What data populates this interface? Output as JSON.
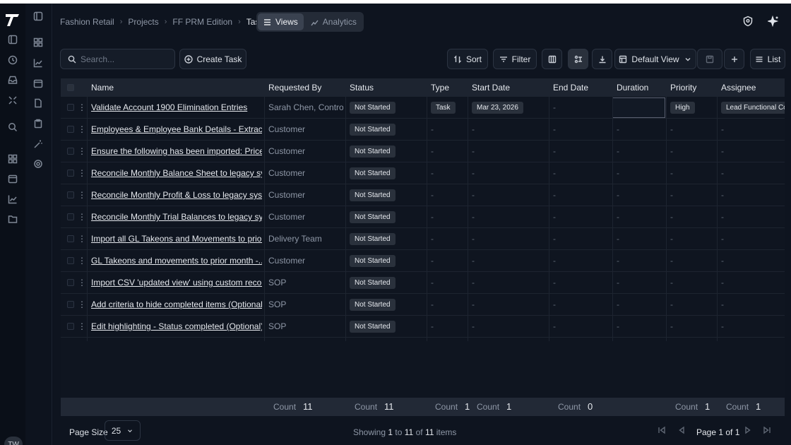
{
  "breadcrumb": [
    "Fashion Retail",
    "Projects",
    "FF PRM Edition",
    "Tasks"
  ],
  "view_tabs": {
    "views": "Views",
    "analytics": "Analytics"
  },
  "toolbar": {
    "search_placeholder": "Search...",
    "create_task": "Create Task",
    "sort": "Sort",
    "filter": "Filter",
    "default_view": "Default View",
    "list": "List"
  },
  "columns": [
    "Name",
    "Requested By",
    "Status",
    "Type",
    "Start Date",
    "End Date",
    "Duration",
    "Priority",
    "Assignee"
  ],
  "rows": [
    {
      "name": "Validate Account 1900 Elimination Entries",
      "requested_by": "Sarah Chen, Control...",
      "status": "Not Started",
      "type": "Task",
      "start": "Mar 23, 2026",
      "end": "-",
      "duration": "",
      "priority": "High",
      "assignee": "Lead Functional Cor"
    },
    {
      "name": "Employees & Employee Bank Details - Extract and...",
      "requested_by": "Customer",
      "status": "Not Started",
      "type": "-",
      "start": "-",
      "end": "-",
      "duration": "-",
      "priority": "-",
      "assignee": "-"
    },
    {
      "name": "Ensure the following has been imported: Price...",
      "requested_by": "Customer",
      "status": "Not Started",
      "type": "-",
      "start": "-",
      "end": "-",
      "duration": "-",
      "priority": "-",
      "assignee": "-"
    },
    {
      "name": "Reconcile Monthly Balance Sheet to legacy system",
      "requested_by": "Customer",
      "status": "Not Started",
      "type": "-",
      "start": "-",
      "end": "-",
      "duration": "-",
      "priority": "-",
      "assignee": "-"
    },
    {
      "name": "Reconcile Monthly Profit & Loss to legacy system",
      "requested_by": "Customer",
      "status": "Not Started",
      "type": "-",
      "start": "-",
      "end": "-",
      "duration": "-",
      "priority": "-",
      "assignee": "-"
    },
    {
      "name": "Reconcile Monthly Trial Balances to legacy system",
      "requested_by": "Customer",
      "status": "Not Started",
      "type": "-",
      "start": "-",
      "end": "-",
      "duration": "-",
      "priority": "-",
      "assignee": "-"
    },
    {
      "name": "Import all GL Takeons and Movements to prior...",
      "requested_by": "Delivery Team",
      "status": "Not Started",
      "type": "-",
      "start": "-",
      "end": "-",
      "duration": "-",
      "priority": "-",
      "assignee": "-"
    },
    {
      "name": "GL Takeons and movements to prior month -...",
      "requested_by": "Customer",
      "status": "Not Started",
      "type": "-",
      "start": "-",
      "end": "-",
      "duration": "-",
      "priority": "-",
      "assignee": "-"
    },
    {
      "name": "Import CSV 'updated view' using custom record...",
      "requested_by": "SOP",
      "status": "Not Started",
      "type": "-",
      "start": "-",
      "end": "-",
      "duration": "-",
      "priority": "-",
      "assignee": "-"
    },
    {
      "name": "Add criteria to hide completed items (Optional)",
      "requested_by": "SOP",
      "status": "Not Started",
      "type": "-",
      "start": "-",
      "end": "-",
      "duration": "-",
      "priority": "-",
      "assignee": "-"
    },
    {
      "name": "Edit highlighting - Status completed (Optional)",
      "requested_by": "SOP",
      "status": "Not Started",
      "type": "-",
      "start": "-",
      "end": "-",
      "duration": "-",
      "priority": "-",
      "assignee": "-"
    }
  ],
  "footer_counts": {
    "label": "Count",
    "requested_by": "11",
    "status": "11",
    "type": "1",
    "start": "1",
    "end": "0",
    "priority": "1",
    "assignee": "1"
  },
  "pager": {
    "page_size_label": "Page Size",
    "page_size": "25",
    "showing_prefix": "Showing",
    "from": "1",
    "to_word": "to",
    "to": "11",
    "of_word": "of",
    "total": "11",
    "items_word": "items",
    "page_label": "Page 1 of 1"
  },
  "avatar_initials": "TW",
  "colors": {
    "background": "#0e141f",
    "header": "#1d2430",
    "badge": "#2a313c",
    "text": "#e6e9ee"
  }
}
